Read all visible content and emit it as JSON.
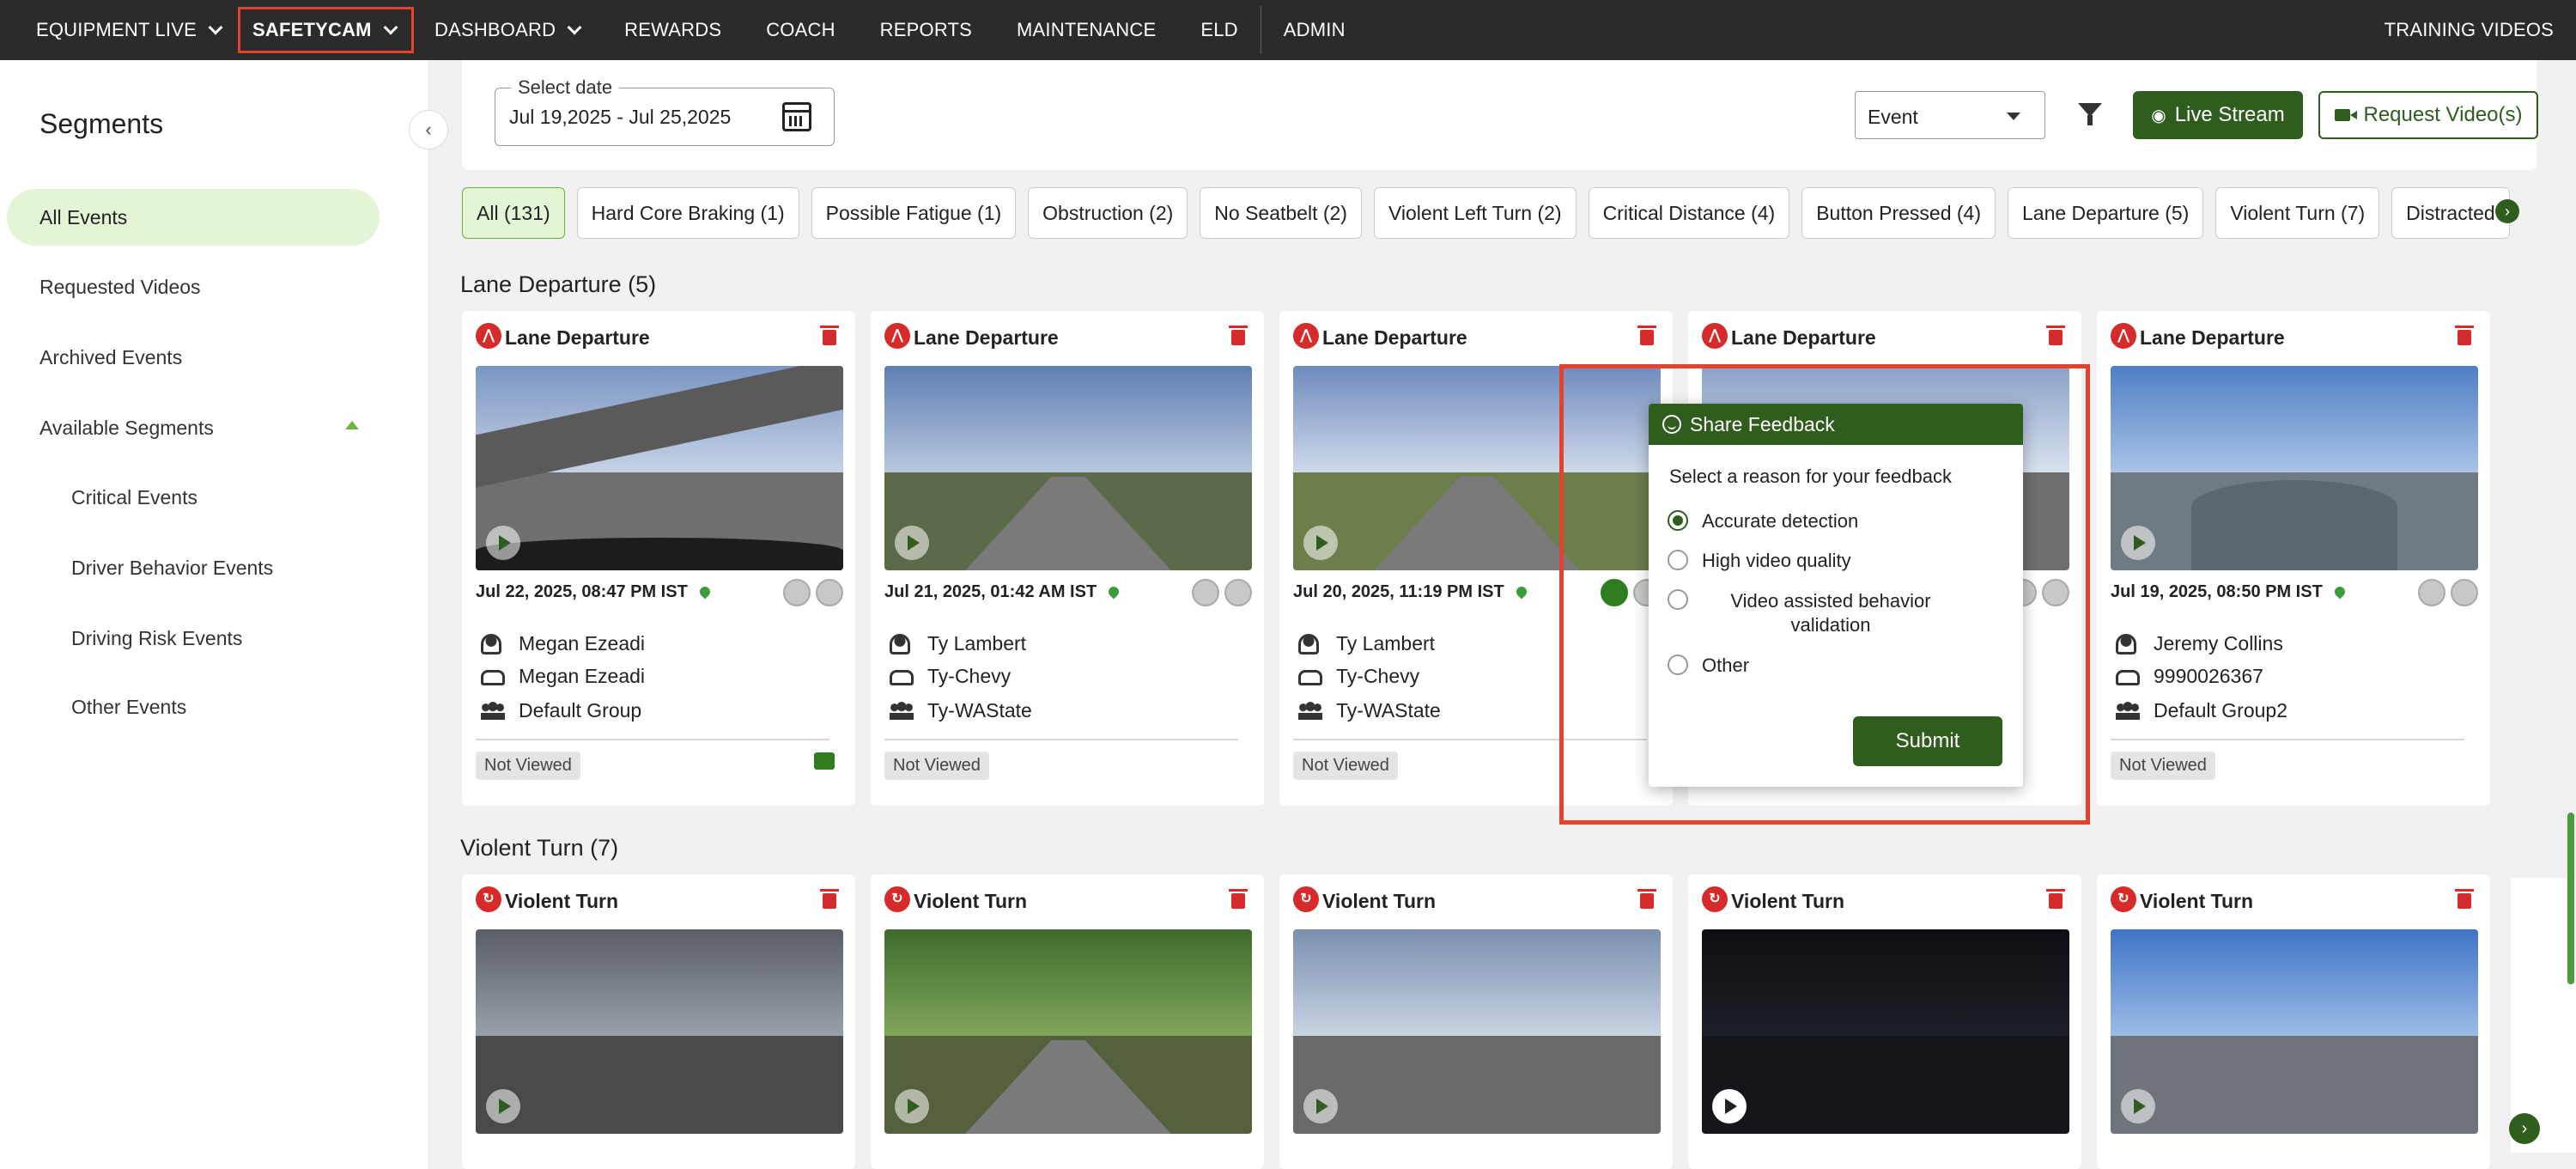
{
  "nav": {
    "equipment_live": "EQUIPMENT LIVE",
    "safetycam": "SAFETYCAM",
    "dashboard": "DASHBOARD",
    "rewards": "REWARDS",
    "coach": "COACH",
    "reports": "REPORTS",
    "maintenance": "MAINTENANCE",
    "eld": "ELD",
    "admin": "ADMIN",
    "training_videos": "TRAINING VIDEOS"
  },
  "sidebar": {
    "title": "Segments",
    "items": {
      "all_events": "All Events",
      "requested_videos": "Requested Videos",
      "archived_events": "Archived Events",
      "available_segments": "Available Segments",
      "critical_events": "Critical Events",
      "driver_behavior_events": "Driver Behavior Events",
      "driving_risk_events": "Driving Risk Events",
      "other_events": "Other Events"
    }
  },
  "filters": {
    "date_label": "Select date",
    "date_value": "Jul 19,2025 - Jul 25,2025",
    "event_select": "Event",
    "live_stream": "Live Stream",
    "request_videos": "Request Video(s)"
  },
  "chips": [
    "All (131)",
    "Hard Core Braking (1)",
    "Possible Fatigue (1)",
    "Obstruction (2)",
    "No Seatbelt (2)",
    "Violent Left Turn (2)",
    "Critical Distance (4)",
    "Button Pressed (4)",
    "Lane Departure (5)",
    "Violent Turn (7)",
    "Distracted"
  ],
  "sections": {
    "lane_departure": "Lane Departure (5)",
    "violent_turn": "Violent Turn (7)"
  },
  "lane_cards": [
    {
      "title": "Lane Departure",
      "date": "Jul 22, 2025, 08:47 PM IST",
      "driver": "Megan Ezeadi",
      "vehicle": "Megan Ezeadi",
      "group": "Default Group",
      "status": "Not Viewed"
    },
    {
      "title": "Lane Departure",
      "date": "Jul 21, 2025, 01:42 AM IST",
      "driver": "Ty Lambert",
      "vehicle": "Ty-Chevy",
      "group": "Ty-WAState",
      "status": "Not Viewed"
    },
    {
      "title": "Lane Departure",
      "date": "Jul 20, 2025, 11:19 PM IST",
      "driver": "Ty Lambert",
      "vehicle": "Ty-Chevy",
      "group": "Ty-WAState",
      "status": "Not Viewed"
    },
    {
      "title": "Lane Departure"
    },
    {
      "title": "Lane Departure",
      "date": "Jul 19, 2025, 08:50 PM IST",
      "driver": "Jeremy Collins",
      "vehicle": "9990026367",
      "group": "Default Group2",
      "status": "Not Viewed"
    }
  ],
  "turn_cards": [
    {
      "title": "Violent Turn"
    },
    {
      "title": "Violent Turn"
    },
    {
      "title": "Violent Turn"
    },
    {
      "title": "Violent Turn"
    },
    {
      "title": "Violent Turn"
    }
  ],
  "feedback": {
    "title": "Share Feedback",
    "subtitle": "Select a reason for your feedback",
    "options": [
      "Accurate detection",
      "High video quality",
      "Video assisted behavior validation",
      "Other"
    ],
    "selected": "Accurate detection",
    "submit": "Submit"
  },
  "colors": {
    "brand_green": "#2f5d1e",
    "highlight_red": "#e5412d",
    "event_red": "#d62b2b"
  }
}
